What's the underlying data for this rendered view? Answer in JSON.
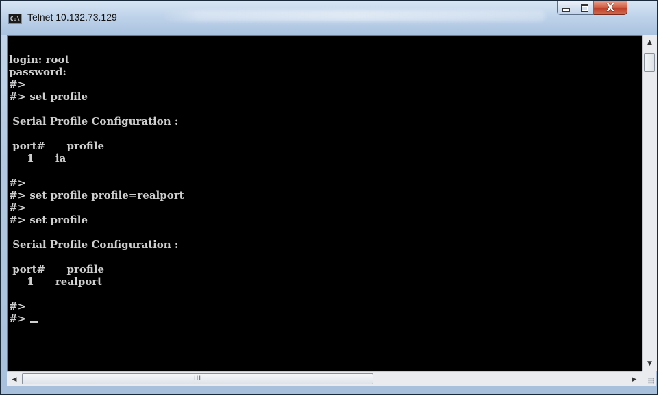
{
  "window": {
    "title": "Telnet 10.132.73.129"
  },
  "caption_buttons": {
    "minimize": "minimize",
    "maximize": "maximize",
    "close": "X"
  },
  "console": {
    "lines": [
      "login: root",
      "password:",
      "#>",
      "#> set profile",
      "",
      " Serial Profile Configuration :",
      "",
      " port#      profile",
      "     1      ia",
      "",
      "#>",
      "#> set profile profile=realport",
      "#>",
      "#> set profile",
      "",
      " Serial Profile Configuration :",
      "",
      " port#      profile",
      "     1      realport",
      "",
      "#>",
      "#> "
    ]
  },
  "scrollbars": {
    "vertical_up": "▲",
    "vertical_down": "▼",
    "horizontal_left": "◀",
    "horizontal_right": "▶",
    "hthumb_grip": "III"
  },
  "colors": {
    "console_bg": "#000000",
    "console_fg": "#cfcfcf",
    "titlebar": "#bfd3ea",
    "close_button": "#c7462f"
  }
}
